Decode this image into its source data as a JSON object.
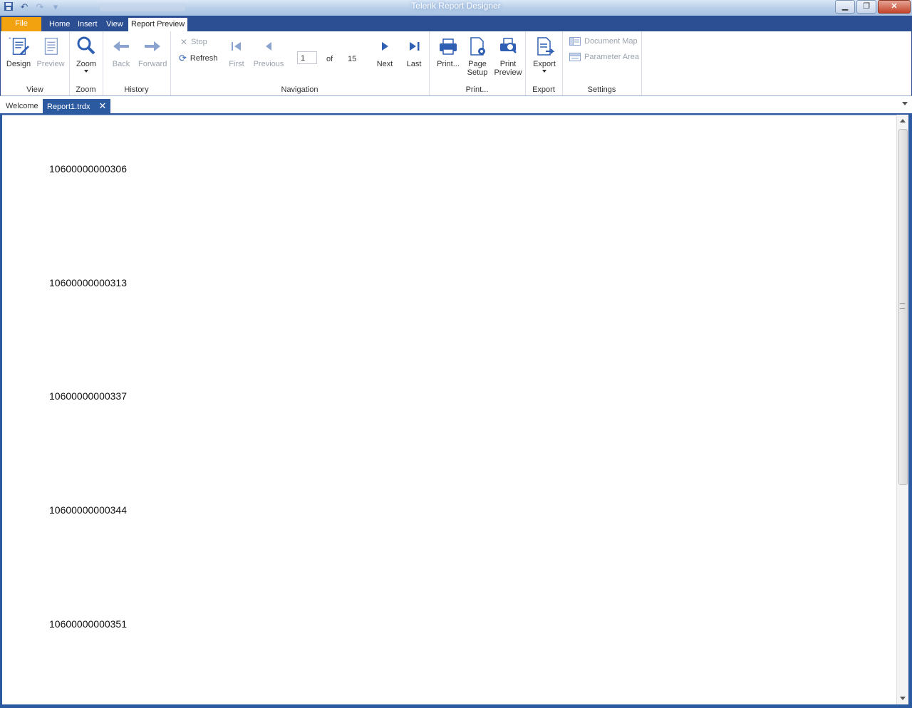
{
  "window": {
    "title": "Telerik Report Designer"
  },
  "menu": {
    "file": "File",
    "tabs": [
      "Home",
      "Insert",
      "View",
      "Report Preview"
    ]
  },
  "ribbon": {
    "view": {
      "design": "Design",
      "preview": "Preview",
      "label": "View"
    },
    "zoom": {
      "zoom": "Zoom",
      "label": "Zoom"
    },
    "history": {
      "back": "Back",
      "forward": "Forward",
      "label": "History"
    },
    "navigation": {
      "stop": "Stop",
      "refresh": "Refresh",
      "first": "First",
      "previous": "Previous",
      "page_value": "1",
      "of": "of",
      "page_count": "15",
      "next": "Next",
      "last": "Last",
      "label": "Navigation"
    },
    "print": {
      "print": "Print...",
      "page_setup_line1": "Page",
      "page_setup_line2": "Setup",
      "print_preview_line1": "Print",
      "print_preview_line2": "Preview",
      "label": "Print..."
    },
    "export": {
      "export": "Export",
      "label": "Export"
    },
    "settings": {
      "document_map": "Document Map",
      "parameter_area": "Parameter Area",
      "label": "Settings"
    }
  },
  "doc_tabs": [
    {
      "label": "Welcome"
    },
    {
      "label": "Report1.trdx"
    }
  ],
  "report_rows": [
    "10600000000306",
    "10600000000313",
    "10600000000337",
    "10600000000344",
    "10600000000351"
  ],
  "colors": {
    "accent": "#2c5aa0",
    "file_tab": "#f2a20f",
    "icon_blue": "#2f5fb3"
  }
}
